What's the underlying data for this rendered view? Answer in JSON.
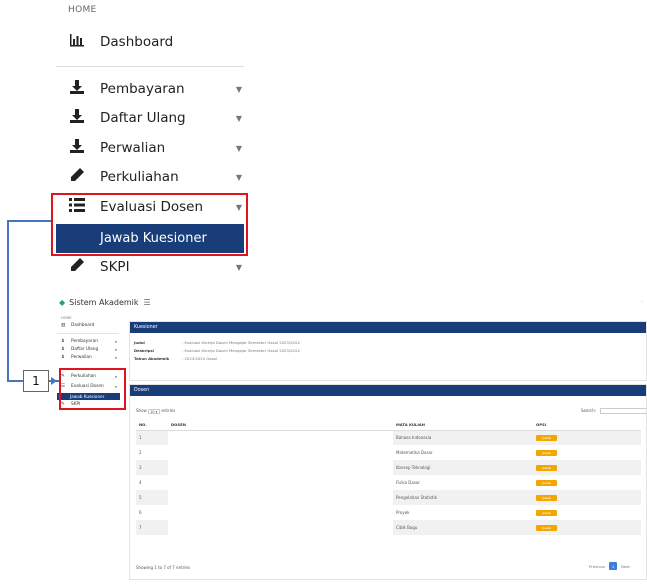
{
  "zoom_sidebar": {
    "home_label": "HOME",
    "dashboard": "Dashboard",
    "items": [
      {
        "label": "Pembayaran",
        "icon": "download-icon"
      },
      {
        "label": "Daftar Ulang",
        "icon": "download-icon"
      },
      {
        "label": "Perwalian",
        "icon": "download-icon"
      },
      {
        "label": "Perkuliahan",
        "icon": "pencil-icon"
      },
      {
        "label": "Evaluasi Dosen",
        "icon": "list-icon"
      },
      {
        "label": "SKPI",
        "icon": "pencil-icon"
      }
    ],
    "active_sub": "Jawab Kuesioner"
  },
  "callout_number": "1",
  "topbar": {
    "app_title": "Sistem Akademik",
    "menu_glyph": "☰",
    "dot": "·"
  },
  "small_sidebar": {
    "home_label": "HOME",
    "dashboard": "Dashboard",
    "items": [
      "Pembayaran",
      "Daftar Ulang",
      "Perwalian",
      "Perkuliahan",
      "Evaluasi Dosen",
      "SKPI"
    ],
    "active_sub": "Jawab Kuesioner"
  },
  "kuesioner": {
    "header": "Kuesioner",
    "rows": [
      {
        "key": "Judul",
        "value": ": Evaluasi Kinerja Dosen Mengajar Semester Gasal 2023/2024"
      },
      {
        "key": "Deskripsi",
        "value": ": Evaluasi Kinerja Dosen Mengajar Semester Gasal 2023/2024"
      },
      {
        "key": "Tahun Akademik",
        "value": ": 2023/2024 Gasal"
      }
    ]
  },
  "dosen": {
    "header": "Dosen",
    "show_label": "Show",
    "show_value": "10",
    "entries_label": "entries",
    "search_label": "Search:",
    "columns": [
      "NO.",
      "DOSEN",
      "MATA KULIAH",
      "OPSI"
    ],
    "rows": [
      {
        "no": "1",
        "dosen": "",
        "mk": "Bahasa Indonesia",
        "btn": "Jawab"
      },
      {
        "no": "2",
        "dosen": "",
        "mk": "Matematika Dasar",
        "btn": "Jawab"
      },
      {
        "no": "3",
        "dosen": "",
        "mk": "Konsep Teknologi",
        "btn": "Jawab"
      },
      {
        "no": "4",
        "dosen": "",
        "mk": "Fisika Dasar",
        "btn": "Jawab"
      },
      {
        "no": "5",
        "dosen": "",
        "mk": "Pengolahan Statistik",
        "btn": "Jawab"
      },
      {
        "no": "6",
        "dosen": "",
        "mk": "Proyek",
        "btn": "Jawab"
      },
      {
        "no": "7",
        "dosen": "",
        "mk": "Ciblk Bagu",
        "btn": "Jawab"
      }
    ],
    "footer": "Showing 1 to 7 of 7 entries",
    "prev": "Previous",
    "page": "1",
    "next": "Next"
  }
}
